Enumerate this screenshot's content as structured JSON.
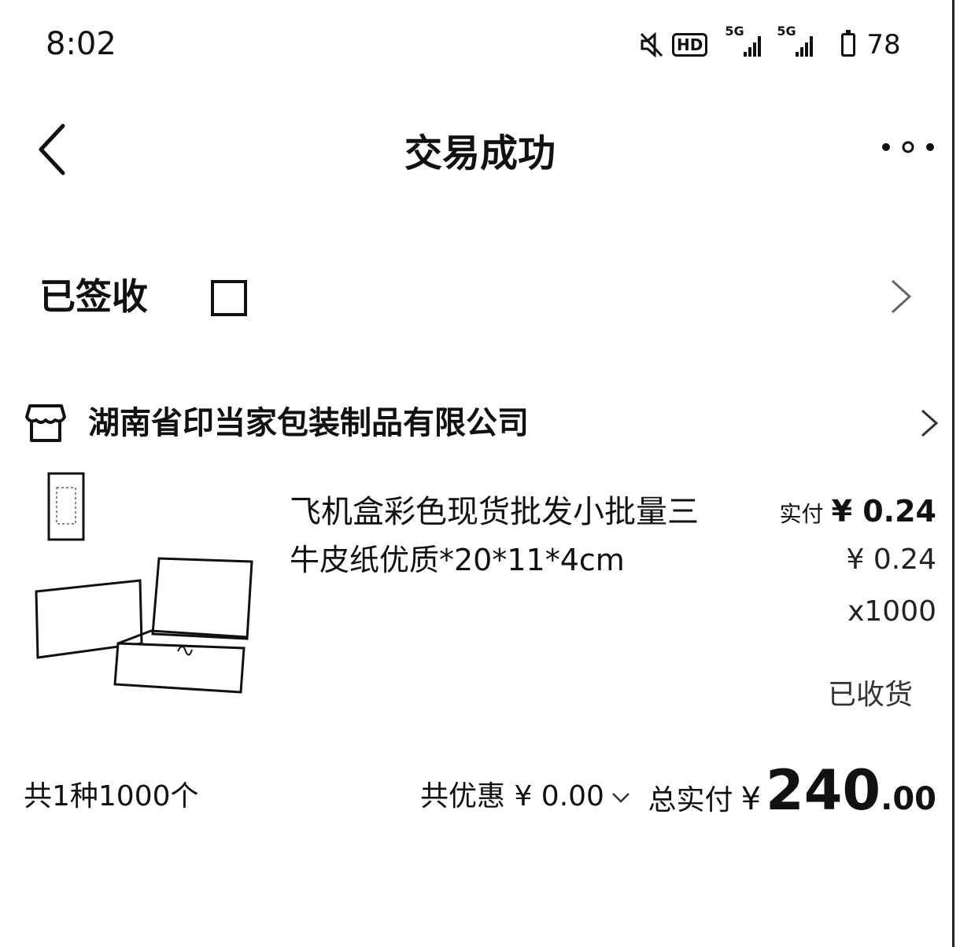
{
  "status_bar": {
    "time": "8:02",
    "hd_badge": "HD",
    "network_1": "5G",
    "network_2": "5G",
    "battery": "78",
    "icons": [
      "mute-icon",
      "hd-icon",
      "signal-icon",
      "signal-icon",
      "battery-icon"
    ]
  },
  "nav": {
    "title": "交易成功",
    "back_icon": "chevron-left-icon",
    "more_icon": "more-dots-icon"
  },
  "order_status": {
    "label": "已签收"
  },
  "store": {
    "name": "湖南省印当家包装制品有限公司",
    "icon": "store-icon"
  },
  "product": {
    "title": "飞机盒彩色现货批发小批量三",
    "spec": "牛皮纸优质*20*11*4cm",
    "paid_label": "实付",
    "paid_price": "¥ 0.24",
    "unit_price": "¥ 0.24",
    "quantity": "x1000",
    "status": "已收货"
  },
  "summary": {
    "item_count": "共1种1000个",
    "discount": "共优惠 ¥ 0.00",
    "total_label": "总实付",
    "currency": "¥",
    "total_integer": "240",
    "total_decimal": ".00"
  }
}
